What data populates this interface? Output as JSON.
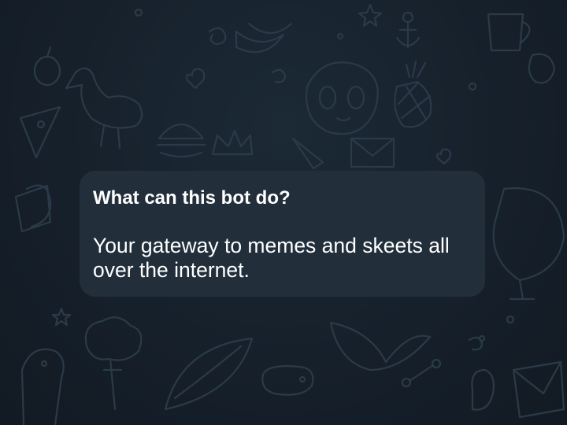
{
  "background": {
    "color": "#16202b",
    "pattern": "doodle-wallpaper",
    "pattern_color": "#2b3a48"
  },
  "bot_info": {
    "title": "What can this bot do?",
    "description": "Your gateway to memes and skeets all over the internet.",
    "bubble_color": "#222f3b",
    "text_color": "#ffffff"
  }
}
